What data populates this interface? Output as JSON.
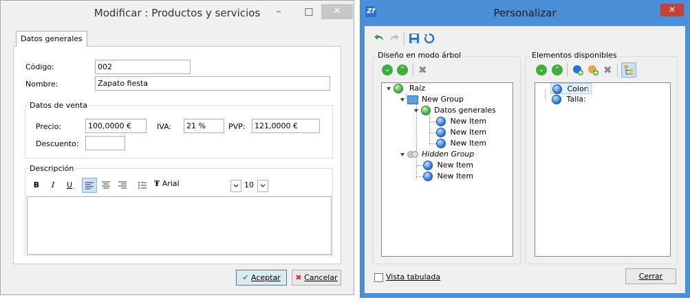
{
  "left_window": {
    "title": "Modificar : Productos y servicios",
    "caption_buttons": {
      "minimize": "–",
      "maximize": "□",
      "close": "✕"
    },
    "tab_label": "Datos generales",
    "codigo": {
      "label": "Código:",
      "value": "002"
    },
    "nombre": {
      "label": "Nombre:",
      "value": "Zapato fiesta"
    },
    "venta": {
      "group_title": "Datos de venta",
      "precio_label": "Precio:",
      "precio_value": "100,0000 €",
      "iva_label": "IVA:",
      "iva_value": "21 %",
      "pvp_label": "PVP:",
      "pvp_value": "121,0000 €",
      "descuento_label": "Descuento:",
      "descuento_value": ""
    },
    "descripcion": {
      "group_title": "Descripción",
      "bold": "B",
      "italic": "I",
      "underline": "U",
      "font_name": "Arial",
      "font_size": "10"
    },
    "aceptar_label": "Aceptar",
    "cancelar_label": "Cancelar"
  },
  "right_window": {
    "app_icon": "Zf",
    "title": "Personalizar",
    "close": "✕",
    "tree_panel_title": "Diseño en modo árbol",
    "tree": {
      "root": "Raíz",
      "group1": "New Group",
      "subgroup": "Datos generales",
      "items_sub": [
        "New Item",
        "New Item",
        "New Item"
      ],
      "hidden_group": "Hidden Group",
      "items_hidden": [
        "New Item",
        "New Item"
      ]
    },
    "available_panel_title": "Elementos disponibles",
    "available_items": [
      "Color:",
      "Talla:"
    ],
    "vista_tabulada_label": "Vista tabulada",
    "cerrar_label": "Cerrar"
  }
}
